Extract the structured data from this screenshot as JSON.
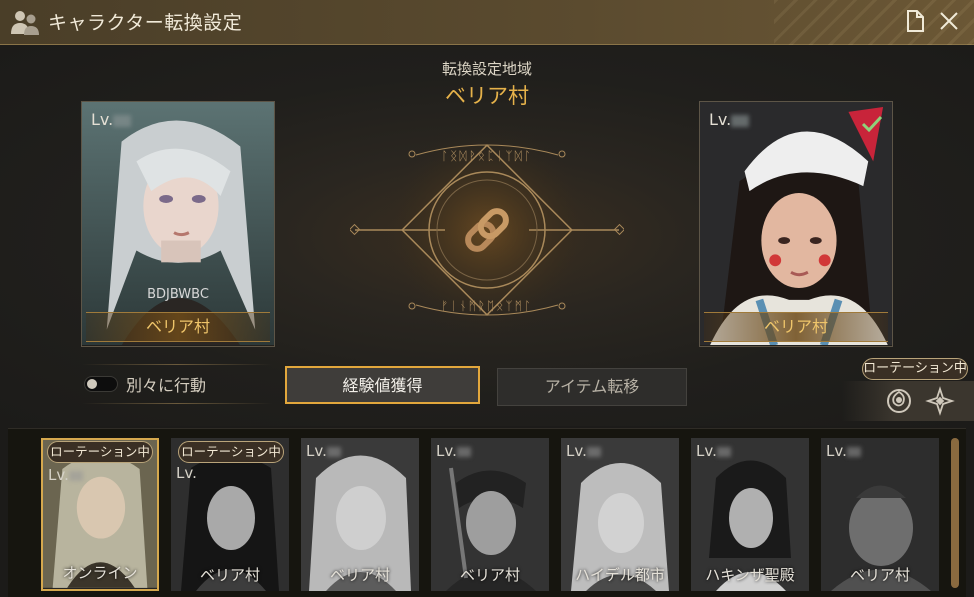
{
  "window": {
    "title": "キャラクター転換設定",
    "icons": [
      "characters-icon",
      "document-icon",
      "close-icon"
    ]
  },
  "transfer": {
    "region_label": "転換設定地域",
    "region_name": "ベリア村"
  },
  "source_character": {
    "level_prefix": "Lv.",
    "name": "BDJBWBC",
    "location": "ベリア村"
  },
  "target_character": {
    "level_prefix": "Lv.",
    "location": "ベリア村",
    "selected": true
  },
  "controls": {
    "toggle_label": "別々に行動",
    "toggle_on": false,
    "tab_exp": "経験値獲得",
    "tab_item": "アイテム転移",
    "rotation_badge": "ローテーション中"
  },
  "character_list": [
    {
      "level_prefix": "Lv.",
      "location": "オンライン",
      "badge": "ローテーション中",
      "selected": true
    },
    {
      "level_prefix": "Lv.",
      "location": "ベリア村",
      "badge": "ローテーション中",
      "selected": false
    },
    {
      "level_prefix": "Lv.",
      "location": "ベリア村",
      "badge": "",
      "selected": false
    },
    {
      "level_prefix": "Lv.",
      "location": "ベリア村",
      "badge": "",
      "selected": false
    },
    {
      "level_prefix": "Lv.",
      "location": "ハイデル都市",
      "badge": "",
      "selected": false
    },
    {
      "level_prefix": "Lv.",
      "location": "ハキンザ聖殿",
      "badge": "",
      "selected": false
    },
    {
      "level_prefix": "Lv.",
      "location": "ベリア村",
      "badge": "",
      "selected": false
    }
  ],
  "colors": {
    "accent_gold": "#e6b24a",
    "title_bar": "#5b4b2f",
    "selected_border": "#e2a73c"
  }
}
